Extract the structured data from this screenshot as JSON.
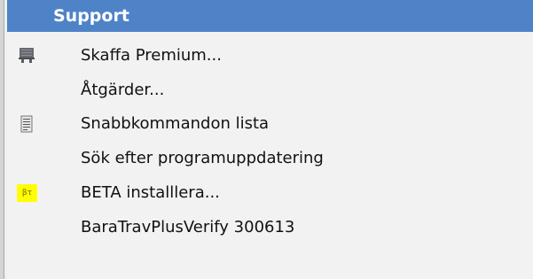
{
  "menu": {
    "title": "Support",
    "items": [
      {
        "label": "Skaffa Premium...",
        "icon": "cart-icon"
      },
      {
        "label": "Åtgärder...",
        "icon": ""
      },
      {
        "label": "Snabbkommandon lista",
        "icon": "list-icon"
      },
      {
        "label": "Sök efter programuppdatering",
        "icon": ""
      },
      {
        "label": "BETA installlera...",
        "icon": "beta-icon",
        "badge": "βτ"
      },
      {
        "label": "BaraTravPlusVerify 300613",
        "icon": ""
      }
    ]
  },
  "colors": {
    "header_bg": "#4f83c7",
    "header_text": "#ffffff",
    "menu_bg": "#f2f2f2",
    "beta_badge": "#ffff00"
  }
}
